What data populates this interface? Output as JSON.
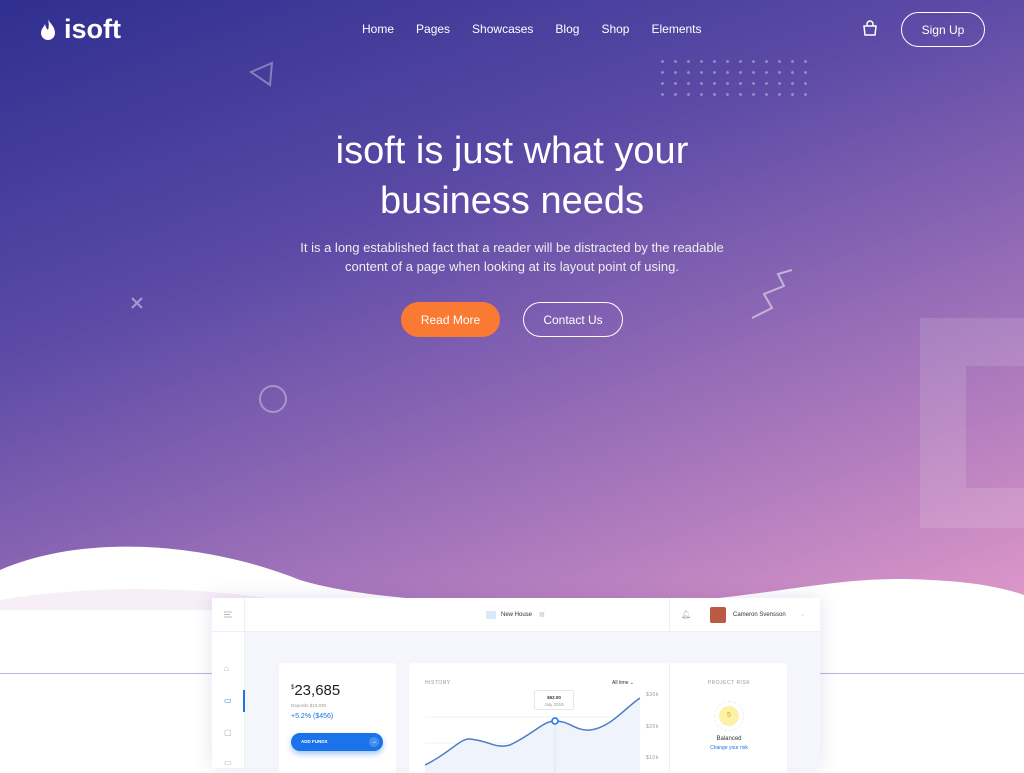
{
  "brand": {
    "name": "isoft",
    "icon": "flame-icon"
  },
  "nav": {
    "items": [
      "Home",
      "Pages",
      "Showcases",
      "Blog",
      "Shop",
      "Elements"
    ],
    "cart_icon": "shopping-bag-icon",
    "signup": "Sign Up"
  },
  "hero": {
    "title_line1": "isoft is just what your",
    "title_line2": "business needs",
    "subtitle_line1": "It is a long established fact that a reader will be distracted by the readable",
    "subtitle_line2": "content of a page when looking at its layout point of using.",
    "read_more": "Read More",
    "contact_us": "Contact Us"
  },
  "colors": {
    "accent": "#fb7a33",
    "primary_blue": "#1a73e8"
  },
  "dashboard": {
    "project": "New House",
    "user": "Cameron Svensson",
    "balance": {
      "currency": "$",
      "amount": "23,685",
      "deposits": "Deposits $10,039",
      "change": "+5.2% ($456)",
      "add_funds": "ADD FUNDS"
    },
    "history": {
      "label": "HISTORY",
      "period": "All time",
      "tooltip_value": "$52.00",
      "tooltip_date": "July 2019",
      "y_ticks": [
        "$30k",
        "$20k",
        "$10k"
      ]
    },
    "risk": {
      "label": "PROJECT RISK",
      "score": "5",
      "status": "Balanced",
      "link": "Change your risk"
    }
  }
}
